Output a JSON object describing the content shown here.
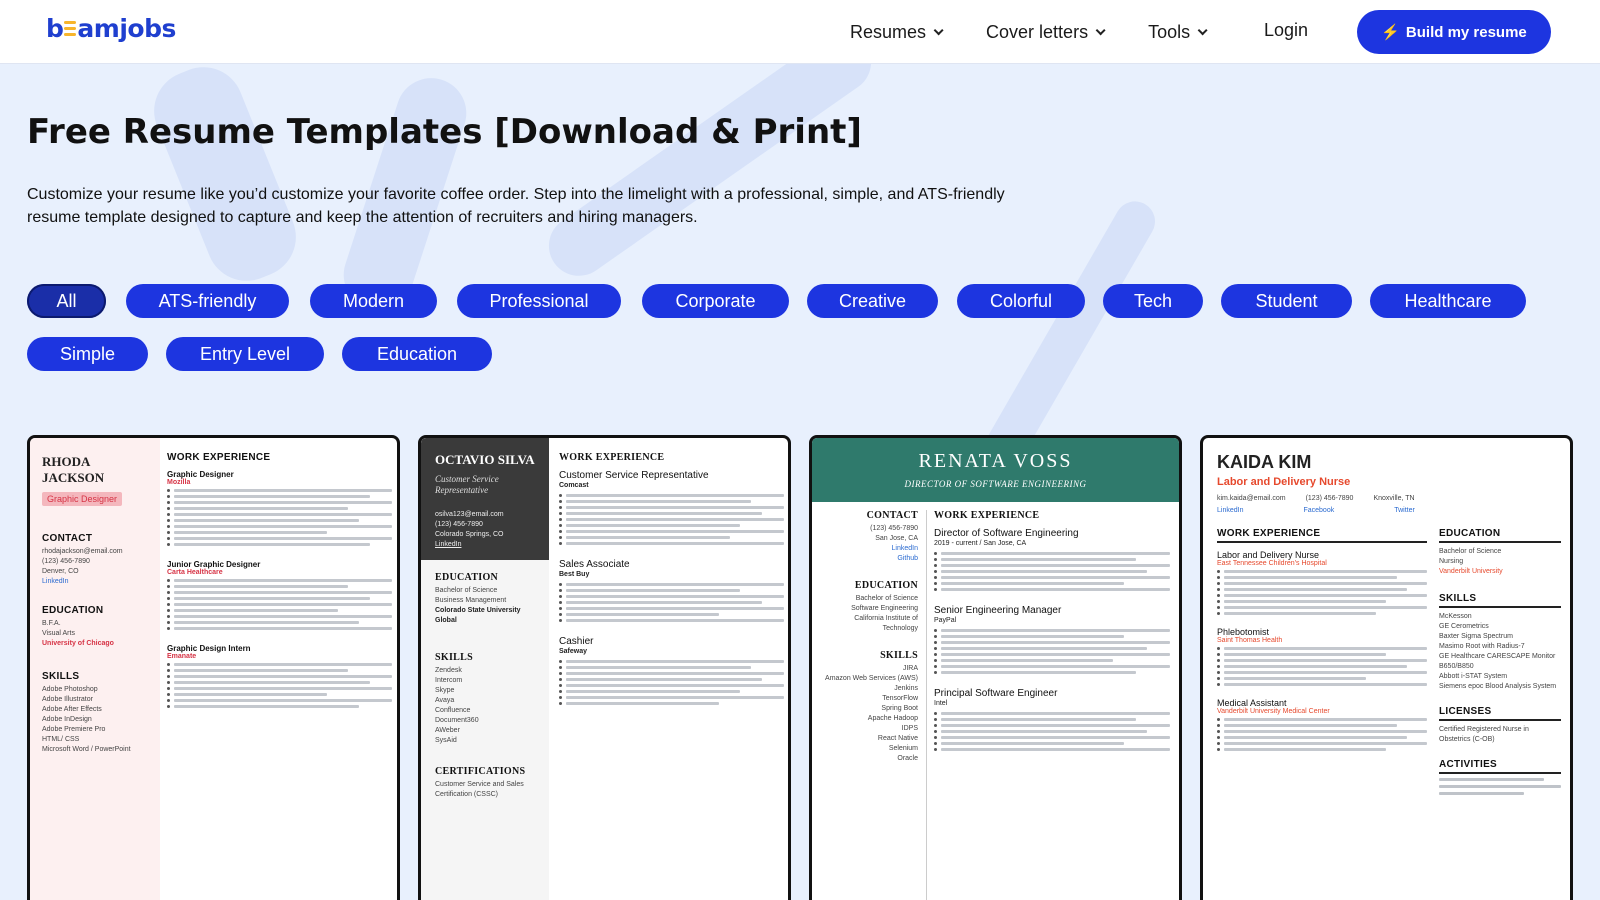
{
  "brand": {
    "logo_part1": "b",
    "logo_part2": "amjobs"
  },
  "nav": {
    "items": [
      {
        "label": "Resumes"
      },
      {
        "label": "Cover letters"
      },
      {
        "label": "Tools"
      }
    ],
    "login": "Login",
    "cta": "Build my resume"
  },
  "hero": {
    "title": "Free Resume Templates [Download & Print]",
    "description": "Customize your resume like you’d customize your favorite coffee order. Step into the limelight with a professional, simple, and ATS-friendly resume template designed to capture and keep the attention of recruiters and hiring managers."
  },
  "filters": [
    "All",
    "ATS-friendly",
    "Modern",
    "Professional",
    "Corporate",
    "Creative",
    "Colorful",
    "Tech",
    "Student",
    "Healthcare",
    "Simple",
    "Entry Level",
    "Education"
  ],
  "active_filter": "All",
  "colors": {
    "primary": "#1d35e0",
    "accent": "#f7b52c",
    "background": "#e8f0fd"
  },
  "templates": [
    {
      "name": "RHODA JACKSON",
      "role": "Graphic Designer",
      "sections": {
        "contact": "CONTACT",
        "education": "EDUCATION",
        "skills": "SKILLS",
        "experience": "WORK EXPERIENCE"
      },
      "jobs": [
        "Graphic Designer",
        "Junior Graphic Designer",
        "Graphic Design Intern"
      ],
      "companies": [
        "Mozilla",
        "Carta Healthcare",
        "Emanate"
      ],
      "email": "rhodajackson@email.com",
      "phone": "(123) 456-7890",
      "location": "Denver, CO",
      "link": "LinkedIn",
      "degree": "B.F.A.",
      "field": "Visual Arts",
      "school": "University of Chicago",
      "skills": [
        "Adobe Photoshop",
        "Adobe Illustrator",
        "Adobe After Effects",
        "Adobe InDesign",
        "Adobe Premiere Pro",
        "HTML/ CSS",
        "Microsoft Word / PowerPoint"
      ]
    },
    {
      "name": "OCTAVIO SILVA",
      "role": "Customer Service Representative",
      "sections": {
        "education": "EDUCATION",
        "skills": "SKILLS",
        "certifications": "CERTIFICATIONS",
        "experience": "WORK EXPERIENCE"
      },
      "jobs": [
        "Customer Service Representative",
        "Sales Associate",
        "Cashier"
      ],
      "companies": [
        "Comcast",
        "Best Buy",
        "Safeway"
      ],
      "email": "osilva123@email.com",
      "phone": "(123) 456-7890",
      "location": "Colorado Springs, CO",
      "link": "LinkedIn",
      "degree": "Bachelor of Science",
      "field": "Business Management",
      "school": "Colorado State University Global",
      "skills": [
        "Zendesk",
        "Intercom",
        "Skype",
        "Avaya",
        "Confluence",
        "Document360",
        "AWeber",
        "SysAid"
      ],
      "certification": "Customer Service and Sales Certification (CSSC)"
    },
    {
      "name": "RENATA VOSS",
      "role": "DIRECTOR OF SOFTWARE ENGINEERING",
      "sections": {
        "contact": "CONTACT",
        "education": "EDUCATION",
        "skills": "SKILLS",
        "experience": "WORK EXPERIENCE"
      },
      "jobs": [
        "Director of Software Engineering",
        "Senior Engineering Manager",
        "Principal Software Engineer"
      ],
      "companies": [
        "2019 - current / San Jose, CA",
        "PayPal",
        "Intel"
      ],
      "phone": "(123) 456-7890",
      "location": "San Jose, CA",
      "links": [
        "LinkedIn",
        "Github"
      ],
      "degree": "Bachelor of Science",
      "field": "Software Engineering",
      "school": "California Institute of Technology",
      "skills": [
        "JIRA",
        "Amazon Web Services (AWS)",
        "Jenkins",
        "TensorFlow",
        "Spring Boot",
        "Apache Hadoop",
        "IDPS",
        "React Native",
        "Selenium",
        "Oracle"
      ]
    },
    {
      "name": "KAIDA KIM",
      "role": "Labor and Delivery Nurse",
      "sections": {
        "experience": "WORK EXPERIENCE",
        "education": "EDUCATION",
        "skills": "SKILLS",
        "licenses": "LICENSES",
        "activities": "ACTIVITIES"
      },
      "jobs": [
        "Labor and Delivery Nurse",
        "Phlebotomist",
        "Medical Assistant"
      ],
      "companies": [
        "East Tennessee Children's Hospital",
        "Saint Thomas Health",
        "Vanderbilt University Medical Center"
      ],
      "email": "kim.kaida@email.com",
      "phone": "(123) 456-7890",
      "location": "Knoxville, TN",
      "links": [
        "LinkedIn",
        "Facebook",
        "Twitter"
      ],
      "degree": "Bachelor of Science",
      "field": "Nursing",
      "school": "Vanderbilt University",
      "skills": [
        "McKesson",
        "GE Cerometrics",
        "Baxter Sigma Spectrum",
        "Masimo Root with Radius-7",
        "GE Healthcare CARESCAPE Monitor B650/B850",
        "Abbott i-STAT System",
        "Siemens epoc Blood Analysis System"
      ],
      "license": "Certified Registered Nurse in Obstetrics (C-OB)"
    }
  ]
}
